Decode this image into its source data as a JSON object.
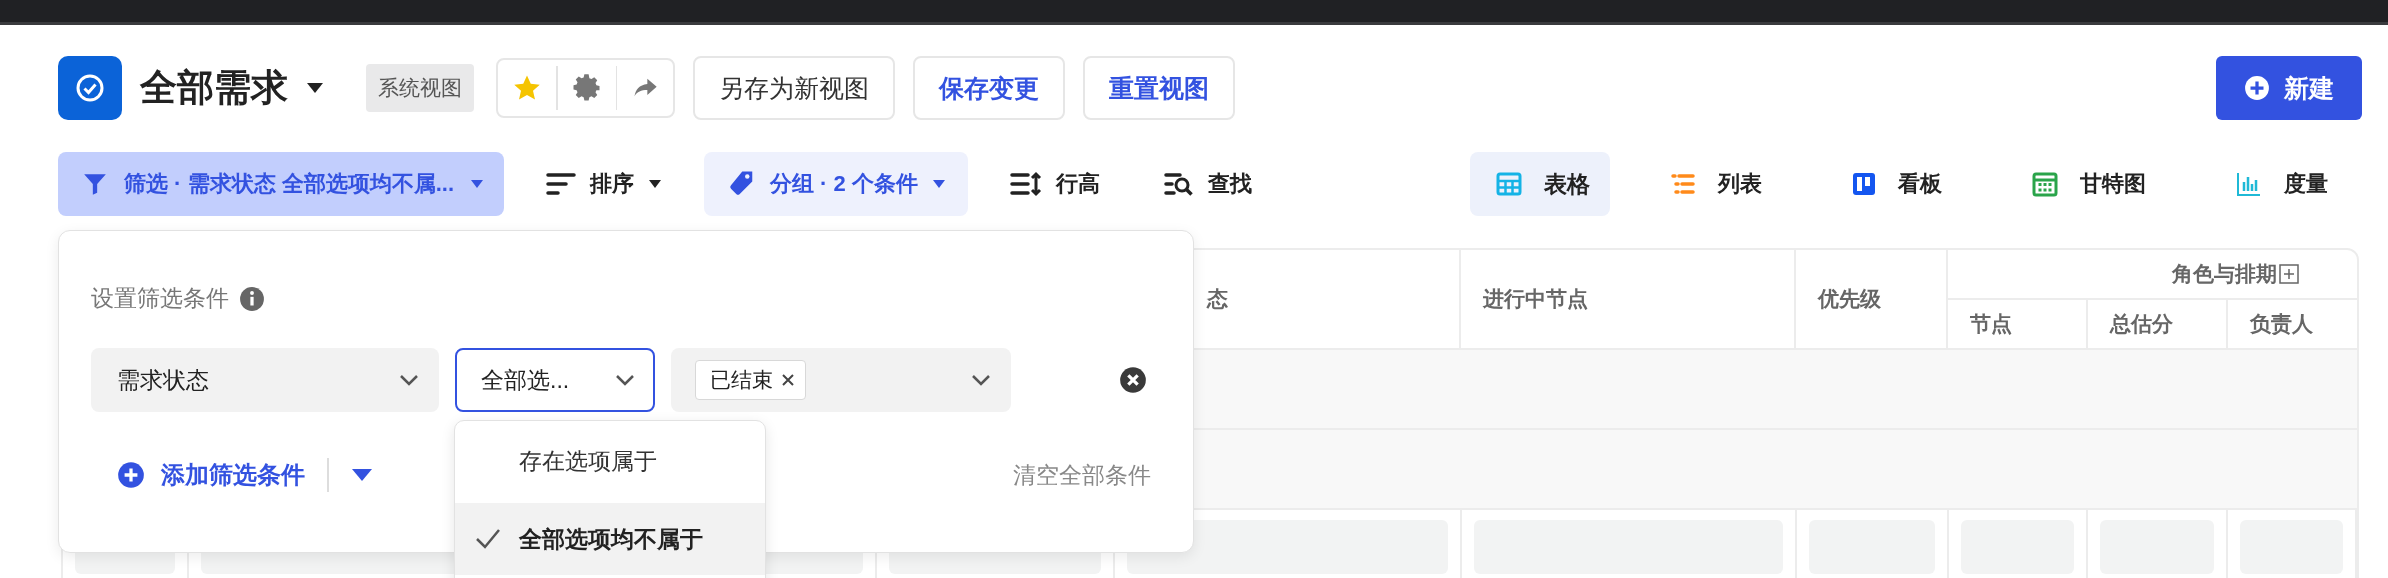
{
  "header": {
    "title": "全部需求",
    "view_badge": "系统视图",
    "buttons": [
      {
        "label": "另存为新视图",
        "kind": "plain"
      },
      {
        "label": "保存变更",
        "kind": "accent"
      },
      {
        "label": "重置视图",
        "kind": "accent"
      }
    ],
    "new_button": "新建"
  },
  "toolbar": {
    "filter": {
      "label": "筛选 · 需求状态 全部选项均不属...",
      "active": true
    },
    "sort": "排序",
    "group": {
      "label": "分组 · 2 个条件",
      "active": true
    },
    "row_height": "行高",
    "find": "查找",
    "views": [
      {
        "label": "表格",
        "kind": "table",
        "selected": true
      },
      {
        "label": "列表",
        "kind": "list",
        "selected": false
      },
      {
        "label": "看板",
        "kind": "board",
        "selected": false
      },
      {
        "label": "甘特图",
        "kind": "gantt",
        "selected": false
      },
      {
        "label": "度量",
        "kind": "metric",
        "selected": false
      }
    ]
  },
  "filter_panel": {
    "title": "设置筛选条件",
    "condition": {
      "field": "需求状态",
      "operator": "全部选...",
      "value_tags": [
        "已结束"
      ]
    },
    "add_label": "添加筛选条件",
    "clear_label": "清空全部条件",
    "operator_menu": [
      {
        "label": "存在选项属于",
        "selected": false
      },
      {
        "label": "全部选项均不属于",
        "selected": true
      }
    ]
  },
  "table": {
    "columns": [
      {
        "label": "态"
      },
      {
        "label": "进行中节点"
      },
      {
        "label": "优先级"
      }
    ],
    "group_column": {
      "label": "角色与排期",
      "children": [
        "节点",
        "总估分",
        "负责人"
      ]
    }
  }
}
